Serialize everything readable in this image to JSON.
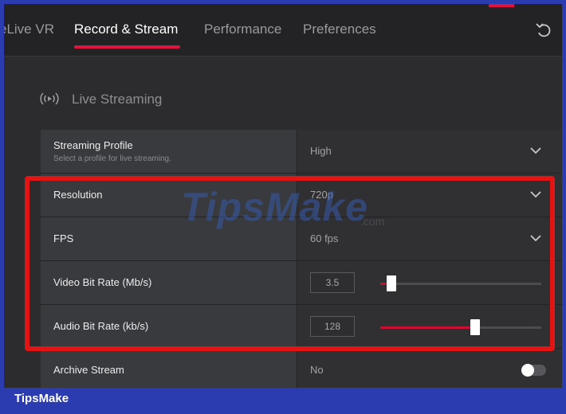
{
  "tabs": [
    {
      "label": "eLive VR",
      "active": false
    },
    {
      "label": "Record & Stream",
      "active": true
    },
    {
      "label": "Performance",
      "active": false
    },
    {
      "label": "Preferences",
      "active": false
    }
  ],
  "section": {
    "title": "Live Streaming",
    "icon": "live-streaming-icon"
  },
  "rows": {
    "streaming_profile": {
      "label": "Streaming Profile",
      "sub": "Select a profile for live streaming.",
      "value": "High"
    },
    "resolution": {
      "label": "Resolution",
      "value": "720p"
    },
    "fps": {
      "label": "FPS",
      "value": "60 fps"
    },
    "video_bit_rate": {
      "label": "Video Bit Rate (Mb/s)",
      "value": "3.5",
      "slider_fraction": 0.07
    },
    "audio_bit_rate": {
      "label": "Audio Bit Rate (kb/s)",
      "value": "128",
      "slider_fraction": 0.59
    },
    "archive_stream": {
      "label": "Archive Stream",
      "value": "No",
      "toggle_on": false
    }
  },
  "watermark": {
    "main": "TipsMake",
    "suffix": ".com"
  },
  "brand": "TipsMake",
  "colors": {
    "accent": "#e0123e",
    "highlight": "#e31414",
    "frame": "#2b3bb0"
  }
}
